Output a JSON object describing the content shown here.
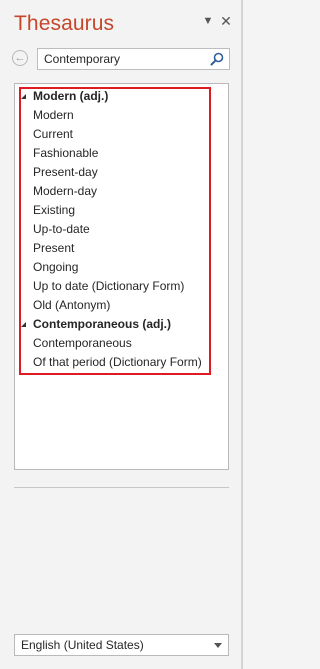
{
  "pane": {
    "title": "Thesaurus",
    "menu_icon": "chevron-down-icon",
    "close_icon": "close-icon"
  },
  "search": {
    "back_icon": "back-arrow-icon",
    "value": "Contemporary",
    "search_icon": "search-icon"
  },
  "results": [
    {
      "label": "Modern (adj.)",
      "type": "heading"
    },
    {
      "label": "Modern",
      "type": "item"
    },
    {
      "label": "Current",
      "type": "item"
    },
    {
      "label": "Fashionable",
      "type": "item"
    },
    {
      "label": "Present-day",
      "type": "item"
    },
    {
      "label": "Modern-day",
      "type": "item"
    },
    {
      "label": "Existing",
      "type": "item"
    },
    {
      "label": "Up-to-date",
      "type": "item"
    },
    {
      "label": "Present",
      "type": "item"
    },
    {
      "label": "Ongoing",
      "type": "item"
    },
    {
      "label": "Up to date (Dictionary Form)",
      "type": "item"
    },
    {
      "label": "Old (Antonym)",
      "type": "item"
    },
    {
      "label": "Contemporaneous (adj.)",
      "type": "heading"
    },
    {
      "label": "Contemporaneous",
      "type": "item"
    },
    {
      "label": "Of that period (Dictionary Form)",
      "type": "item"
    }
  ],
  "language": {
    "selected": "English (United States)"
  },
  "colors": {
    "title": "#c5472b",
    "highlight_border": "#e01a22"
  }
}
